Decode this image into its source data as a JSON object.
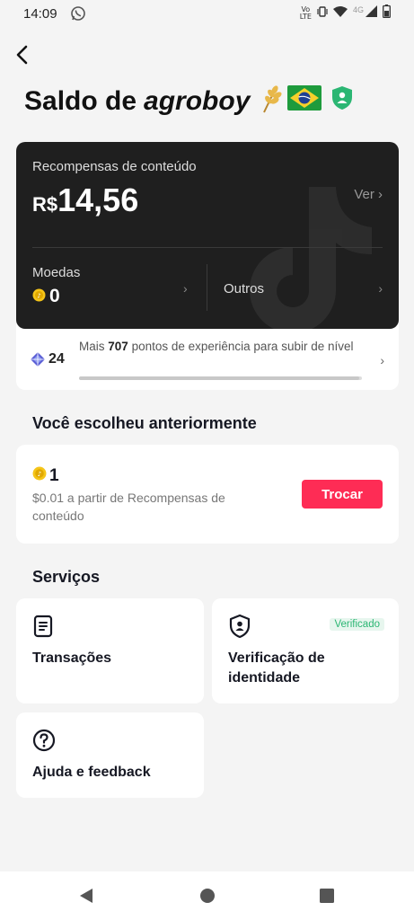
{
  "status_bar": {
    "time": "14:09",
    "volte_top": "Vo",
    "volte_bottom": "LTE",
    "network": "4G"
  },
  "header": {
    "title_prefix": "Saldo de",
    "username": "agroboy"
  },
  "rewards": {
    "label": "Recompensas de conteúdo",
    "currency": "R$",
    "amount": "14,56",
    "view_link": "Ver ›",
    "coins_label": "Moedas",
    "coins_value": "0",
    "others_label": "Outros"
  },
  "level": {
    "number": "24",
    "text_prefix": "Mais",
    "points": "707",
    "text_suffix": "pontos de experiência para subir de nível",
    "progress": 0.99
  },
  "previous": {
    "title": "Você escolheu anteriormente",
    "amount": "1",
    "description": "$0.01 a partir de Recompensas de conteúdo",
    "button": "Trocar"
  },
  "services": {
    "title": "Serviços",
    "transactions": "Transações",
    "identity_line1": "Verificação de",
    "identity_line2": "identidade",
    "verified_badge": "Verificado",
    "help": "Ajuda e feedback"
  },
  "colors": {
    "accent": "#fe2c55",
    "coin": "#f5c518",
    "verified": "#2bb673",
    "dark_card": "#1f1f1f"
  },
  "icons": [
    "back-arrow-icon",
    "whatsapp-icon",
    "wheat-icon",
    "brazil-flag-icon",
    "shield-badge-icon",
    "tiktok-logo-icon",
    "coin-icon",
    "level-gem-icon",
    "document-icon",
    "id-shield-icon",
    "help-circle-icon",
    "nav-back-icon",
    "nav-home-icon",
    "nav-recents-icon"
  ]
}
